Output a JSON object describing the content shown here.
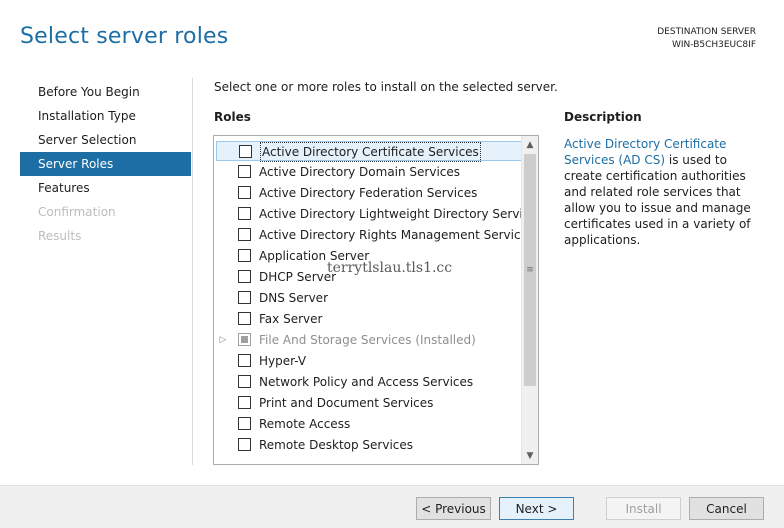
{
  "page": {
    "title": "Select server roles",
    "destination_label": "DESTINATION SERVER",
    "destination_server": "WIN-B5CH3EUC8IF"
  },
  "sidebar": {
    "items": [
      {
        "label": "Before You Begin",
        "state": "normal"
      },
      {
        "label": "Installation Type",
        "state": "normal"
      },
      {
        "label": "Server Selection",
        "state": "normal"
      },
      {
        "label": "Server Roles",
        "state": "active"
      },
      {
        "label": "Features",
        "state": "normal"
      },
      {
        "label": "Confirmation",
        "state": "disabled"
      },
      {
        "label": "Results",
        "state": "disabled"
      }
    ]
  },
  "main": {
    "instructions": "Select one or more roles to install on the selected server.",
    "roles_heading": "Roles",
    "roles": [
      {
        "label": "Active Directory Certificate Services",
        "checked": false,
        "selected": true
      },
      {
        "label": "Active Directory Domain Services",
        "checked": false
      },
      {
        "label": "Active Directory Federation Services",
        "checked": false
      },
      {
        "label": "Active Directory Lightweight Directory Services",
        "checked": false
      },
      {
        "label": "Active Directory Rights Management Services",
        "checked": false
      },
      {
        "label": "Application Server",
        "checked": false
      },
      {
        "label": "DHCP Server",
        "checked": false
      },
      {
        "label": "DNS Server",
        "checked": false
      },
      {
        "label": "Fax Server",
        "checked": false
      },
      {
        "label": "File And Storage Services (Installed)",
        "checked": "partial",
        "installed": true,
        "expandable": true
      },
      {
        "label": "Hyper-V",
        "checked": false
      },
      {
        "label": "Network Policy and Access Services",
        "checked": false
      },
      {
        "label": "Print and Document Services",
        "checked": false
      },
      {
        "label": "Remote Access",
        "checked": false
      },
      {
        "label": "Remote Desktop Services",
        "checked": false
      }
    ],
    "description_heading": "Description",
    "description_link": "Active Directory Certificate Services (AD CS)",
    "description_body": " is used to create certification authorities and related role services that allow you to issue and manage certificates used in a variety of applications.",
    "watermark": "terrytlslau.tls1.cc"
  },
  "footer": {
    "previous_label": "< Previous",
    "next_label": "Next >",
    "install_label": "Install",
    "cancel_label": "Cancel"
  },
  "colors": {
    "accent": "#1c6ea4",
    "selected_row": "#e5f1fb",
    "footer_bg": "#f0f0f0"
  }
}
